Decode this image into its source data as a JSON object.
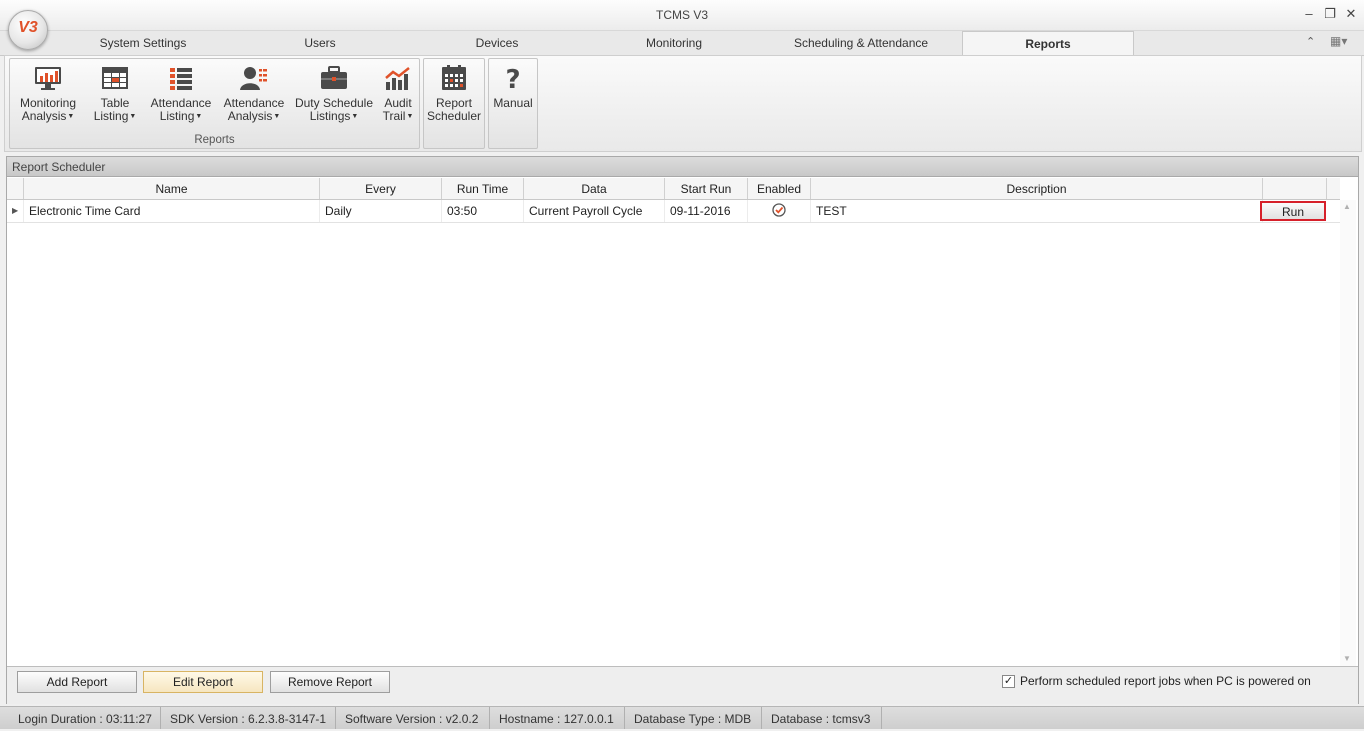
{
  "window": {
    "title": "TCMS V3",
    "logo_text": "V3"
  },
  "tabs": [
    {
      "label": "System Settings"
    },
    {
      "label": "Users"
    },
    {
      "label": "Devices"
    },
    {
      "label": "Monitoring"
    },
    {
      "label": "Scheduling & Attendance"
    },
    {
      "label": "Reports",
      "active": true
    }
  ],
  "ribbon": {
    "groups": [
      {
        "label": "Reports",
        "buttons": [
          {
            "line1": "Monitoring",
            "line2": "Analysis",
            "dropdown": true,
            "icon": "monitor-chart-icon"
          },
          {
            "line1": "Table",
            "line2": "Listing",
            "dropdown": true,
            "icon": "table-icon"
          },
          {
            "line1": "Attendance",
            "line2": "Listing",
            "dropdown": true,
            "icon": "list-icon"
          },
          {
            "line1": "Attendance",
            "line2": "Analysis",
            "dropdown": true,
            "icon": "user-list-icon"
          },
          {
            "line1": "Duty Schedule",
            "line2": "Listings",
            "dropdown": true,
            "icon": "briefcase-icon"
          },
          {
            "line1": "Audit",
            "line2": "Trail",
            "dropdown": true,
            "icon": "trend-chart-icon"
          }
        ]
      },
      {
        "label": "",
        "buttons": [
          {
            "line1": "Report",
            "line2": "Scheduler",
            "icon": "calendar-icon"
          }
        ]
      },
      {
        "label": "",
        "buttons": [
          {
            "line1": "Manual",
            "line2": "",
            "icon": "question-icon"
          }
        ]
      }
    ]
  },
  "panel": {
    "title": "Report Scheduler",
    "columns": [
      "Name",
      "Every",
      "Run Time",
      "Data",
      "Start Run",
      "Enabled",
      "Description"
    ],
    "rows": [
      {
        "name": "Electronic Time Card",
        "every": "Daily",
        "run_time": "03:50",
        "data": "Current Payroll Cycle",
        "start_run": "09-11-2016",
        "enabled": true,
        "description": "TEST",
        "action": "Run"
      }
    ],
    "buttons": {
      "add": "Add Report",
      "edit": "Edit Report",
      "remove": "Remove Report"
    },
    "checkbox": {
      "label": "Perform scheduled report jobs when PC is powered on",
      "checked": true
    }
  },
  "status": {
    "login_duration": "Login Duration : 03:11:27",
    "sdk_version": "SDK Version : 6.2.3.8-3147-1",
    "software_version": "Software Version : v2.0.2",
    "hostname": "Hostname : 127.0.0.1",
    "database_type": "Database Type : MDB",
    "database": "Database : tcmsv3"
  },
  "colors": {
    "accent": "#e0522a",
    "run_highlight": "#d6202a",
    "icon_dark": "#4a4a4a"
  }
}
